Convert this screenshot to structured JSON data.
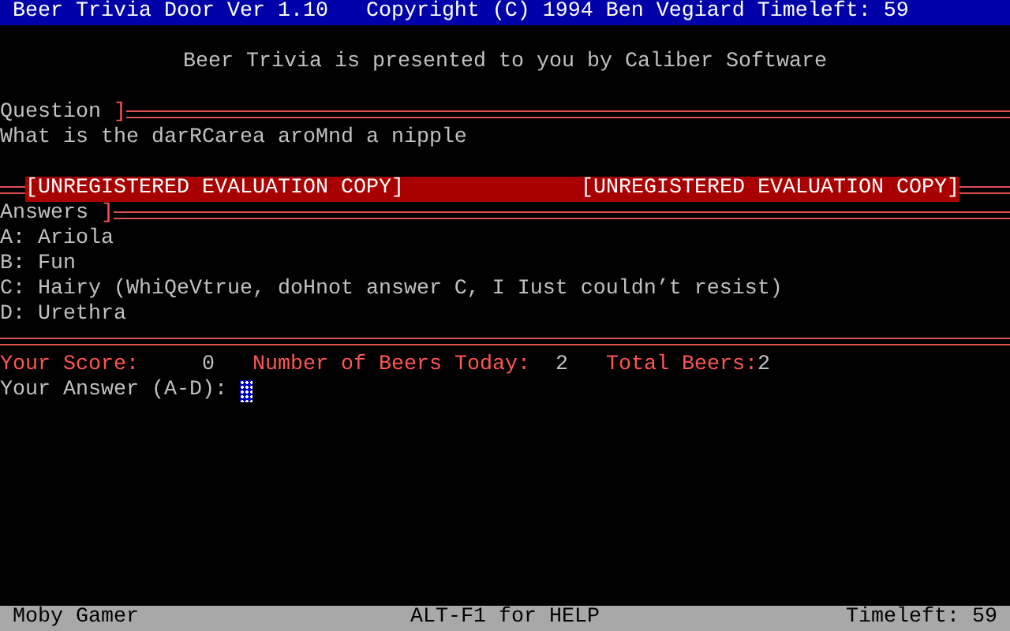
{
  "title_bar": {
    "text": "Beer Trivia Door Ver 1.10   Copyright (C) 1994 Ben Vegiard Timeleft: 59"
  },
  "banner": "Beer Trivia is presented to you by Caliber Software",
  "question": {
    "label": "Question ",
    "bracket": "]",
    "text": "What is the darRCarea aroMnd a nipple"
  },
  "unregistered": [
    "[UNREGISTERED EVALUATION COPY]",
    "[UNREGISTERED EVALUATION COPY]"
  ],
  "answers": {
    "label": "Answers ",
    "bracket": "]",
    "items": [
      "A: Ariola",
      "B: Fun",
      "C: Hairy (WhiQeVtrue, doHnot answer C, I Iust couldn’t resist)",
      "D: Urethra"
    ]
  },
  "stats": [
    {
      "label": "Your Score:",
      "value": "0"
    },
    {
      "label": "Number of Beers Today:",
      "value": "2"
    },
    {
      "label": "Total Beers:",
      "value": "2"
    }
  ],
  "prompt": {
    "label": "Your Answer (A-D):"
  },
  "status_bar": {
    "left": "Moby Gamer",
    "center": "ALT-F1 for HELP",
    "right": "Timeleft: 59"
  }
}
